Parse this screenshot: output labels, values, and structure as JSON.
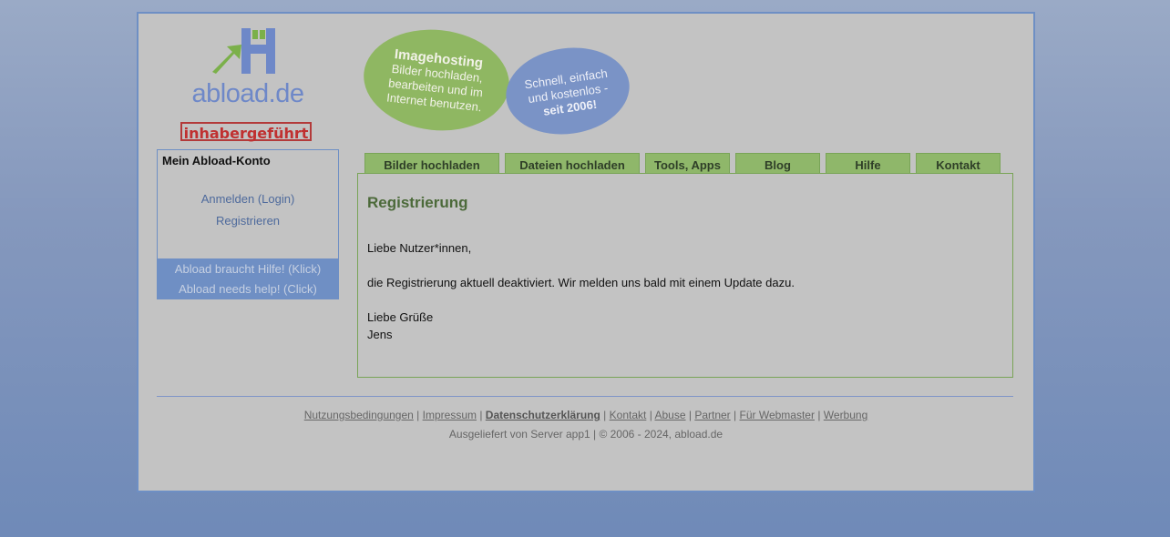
{
  "logo": {
    "text": "abload.de",
    "badge": "inhabergeführt"
  },
  "stickers": {
    "green": {
      "title": "Imagehosting",
      "lines": [
        "Bilder hochladen,",
        "bearbeiten und im",
        "Internet benutzen."
      ]
    },
    "blue": {
      "lines": [
        "Schnell, einfach",
        "und kostenlos -",
        "seit 2006!"
      ]
    }
  },
  "account": {
    "title": "Mein Abload-Konto",
    "login": "Anmelden (Login)",
    "register": "Registrieren",
    "help_de": "Abload braucht Hilfe! (Klick)",
    "help_en": "Abload needs help! (Click)"
  },
  "tabs": [
    "Bilder hochladen",
    "Dateien hochladen",
    "Tools, Apps",
    "Blog",
    "Hilfe",
    "Kontakt"
  ],
  "content": {
    "title": "Registrierung",
    "greeting": "Liebe Nutzer*innen,",
    "message": "die Registrierung aktuell deaktiviert. Wir melden uns bald mit einem Update dazu.",
    "closing": "Liebe Grüße",
    "signature": "Jens"
  },
  "footer": {
    "links": [
      "Nutzungsbedingungen",
      "Impressum",
      "Datenschutzerklärung",
      "Kontakt",
      "Abuse",
      "Partner",
      "Für Webmaster",
      "Werbung"
    ],
    "separator": "|",
    "meta": "Ausgeliefert von Server app1 | © 2006 - 2024, abload.de"
  },
  "colors": {
    "page_bg": "#8598bd",
    "frame_bg": "#c3c3c3",
    "frame_border": "#6e8fc4",
    "tab_bg": "#8fb76a",
    "title_green": "#4c6a3a",
    "link_blue": "#4e6a9c"
  }
}
